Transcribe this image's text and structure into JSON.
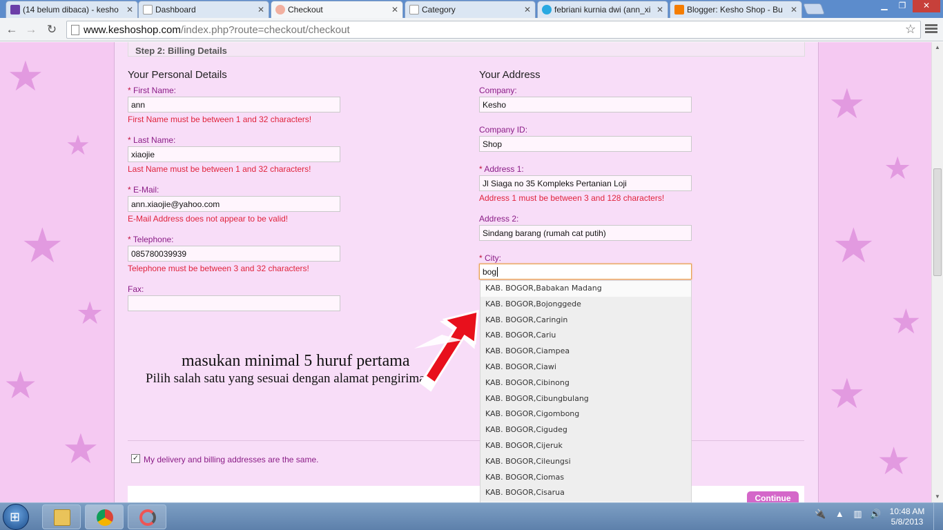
{
  "browser": {
    "tabs": [
      {
        "title": "(14 belum dibaca) - kesho",
        "icon": "mail-icon",
        "color": "#6b3ea8"
      },
      {
        "title": "Dashboard",
        "icon": "page-icon",
        "color": "#ffffff"
      },
      {
        "title": "Checkout",
        "icon": "shop-icon",
        "color": "#e88"
      },
      {
        "title": "Category",
        "icon": "page-icon",
        "color": "#ffffff"
      },
      {
        "title": "febriani kurnia dwi (ann_xi",
        "icon": "twitter-icon",
        "color": "#29a9e1"
      },
      {
        "title": "Blogger: Kesho Shop - Bu",
        "icon": "blogger-icon",
        "color": "#f57d00"
      }
    ],
    "url_host": "www.keshoshop.com",
    "url_path": "/index.php?route=checkout/checkout"
  },
  "checkout": {
    "step_title": "Step 2: Billing Details",
    "personal_heading": "Your Personal Details",
    "address_heading": "Your Address",
    "required_mark": "* ",
    "first_name": {
      "label": "First Name:",
      "value": "ann",
      "error": "First Name must be between 1 and 32 characters!"
    },
    "last_name": {
      "label": "Last Name:",
      "value": "xiaojie",
      "error": "Last Name must be between 1 and 32 characters!"
    },
    "email": {
      "label": "E-Mail:",
      "value": "ann.xiaojie@yahoo.com",
      "error": "E-Mail Address does not appear to be valid!"
    },
    "telephone": {
      "label": "Telephone:",
      "value": "085780039939",
      "error": "Telephone must be between 3 and 32 characters!"
    },
    "fax": {
      "label": "Fax:",
      "value": ""
    },
    "company": {
      "label": "Company:",
      "value": "Kesho"
    },
    "company_id": {
      "label": "Company ID:",
      "value": "Shop"
    },
    "address1": {
      "label": "Address 1:",
      "value": "Jl Siaga no 35 Kompleks Pertanian Loji",
      "error": "Address 1 must be between 3 and 128 characters!"
    },
    "address2": {
      "label": "Address 2:",
      "value": "Sindang barang (rumah cat putih)"
    },
    "city": {
      "label": "City:",
      "value": "bog"
    },
    "city_suggestions": [
      "KAB. BOGOR,Babakan Madang",
      "KAB. BOGOR,Bojonggede",
      "KAB. BOGOR,Caringin",
      "KAB. BOGOR,Cariu",
      "KAB. BOGOR,Ciampea",
      "KAB. BOGOR,Ciawi",
      "KAB. BOGOR,Cibinong",
      "KAB. BOGOR,Cibungbulang",
      "KAB. BOGOR,Cigombong",
      "KAB. BOGOR,Cigudeg",
      "KAB. BOGOR,Cijeruk",
      "KAB. BOGOR,Cileungsi",
      "KAB. BOGOR,Ciomas",
      "KAB. BOGOR,Cisarua"
    ],
    "same_address_label": "My delivery and billing addresses are the same.",
    "same_address_checked": true,
    "continue_label": "Continue"
  },
  "annotation": {
    "line1": "masukan minimal 5 huruf pertama",
    "line2": "Pilih salah satu yang sesuai dengan alamat pengiriman",
    "arrow_color": "#e8101c"
  },
  "taskbar": {
    "time": "10:48 AM",
    "date": "5/8/2013"
  }
}
